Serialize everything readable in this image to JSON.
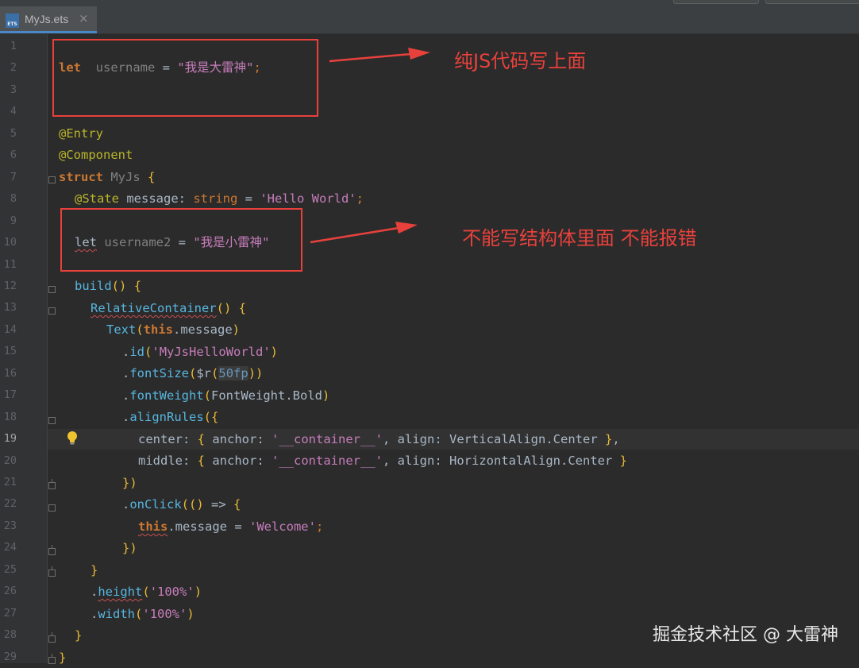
{
  "tab": {
    "icon_label": "ETS",
    "file_name": "MyJs.ets",
    "close_glyph": "×"
  },
  "line_numbers": [
    "1",
    "2",
    "3",
    "4",
    "5",
    "6",
    "7",
    "8",
    "9",
    "10",
    "11",
    "12",
    "13",
    "14",
    "15",
    "16",
    "17",
    "18",
    "19",
    "20",
    "21",
    "22",
    "23",
    "24",
    "25",
    "26",
    "27",
    "28",
    "29"
  ],
  "current_line": "19",
  "code": {
    "l2": {
      "let": "let",
      "name": "username",
      "eq": " = ",
      "value": "\"我是大雷神\"",
      "semi": ";"
    },
    "l5": "@Entry",
    "l6": "@Component",
    "l7": {
      "struct": "struct",
      "name": "MyJs",
      "brace": "{"
    },
    "l8": {
      "decorator": "@State",
      "name": "message",
      "colon": ": ",
      "type": "string",
      "eq": " = ",
      "value": "'Hello World'",
      "semi": ";"
    },
    "l10": {
      "let": "let",
      "name": "username2",
      "eq": " = ",
      "value": "\"我是小雷神\""
    },
    "l12": {
      "name": "build",
      "parens": "()",
      "brace": "{"
    },
    "l13": {
      "name": "RelativeContainer",
      "parens": "()",
      "brace": "{"
    },
    "l14": {
      "name": "Text",
      "open": "(",
      "this": "this",
      "rest": ".message",
      "close": ")"
    },
    "l15": {
      "dot": ".",
      "name": "id",
      "open": "(",
      "value": "'MyJsHelloWorld'",
      "close": ")"
    },
    "l16": {
      "dot": ".",
      "name": "fontSize",
      "open": "(",
      "fn": "$r",
      "open2": "(",
      "value": "50fp",
      "close": "))"
    },
    "l17": {
      "dot": ".",
      "name": "fontWeight",
      "open": "(",
      "value": "FontWeight.Bold",
      "close": ")"
    },
    "l18": {
      "dot": ".",
      "name": "alignRules",
      "open": "({"
    },
    "l19": {
      "key": "center",
      "colon": ": ",
      "ob": "{ ",
      "k1": "anchor",
      "c1": ": ",
      "v1": "'__container__'",
      "sep": ", ",
      "k2": "align",
      "c2": ": ",
      "v2": "VerticalAlign.Center",
      "cb": " }",
      "end": ","
    },
    "l20": {
      "key": "middle",
      "colon": ": ",
      "ob": "{ ",
      "k1": "anchor",
      "c1": ": ",
      "v1": "'__container__'",
      "sep": ", ",
      "k2": "align",
      "c2": ": ",
      "v2": "HorizontalAlign.Center",
      "cb": " }"
    },
    "l21": "})",
    "l22": {
      "dot": ".",
      "name": "onClick",
      "open": "(",
      "args": "()",
      "arrow": " => ",
      "brace": "{"
    },
    "l23": {
      "this": "this",
      "rest": ".message = ",
      "value": "'Welcome'",
      "semi": ";"
    },
    "l24": "})",
    "l25": "}",
    "l26": {
      "dot": ".",
      "name": "height",
      "open": "(",
      "value": "'100%'",
      "close": ")"
    },
    "l27": {
      "dot": ".",
      "name": "width",
      "open": "(",
      "value": "'100%'",
      "close": ")"
    },
    "l28": "}",
    "l29": "}"
  },
  "annotations": {
    "top_note": "纯JS代码写上面",
    "middle_note": "不能写结构体里面 不能报错",
    "color": "#e8413c"
  },
  "watermark": "掘金技术社区 @ 大雷神",
  "icons": {
    "fold_marker": "fold-marker-icon",
    "intention_bulb": "lightbulb-icon",
    "file_type": "ets-file-icon"
  }
}
